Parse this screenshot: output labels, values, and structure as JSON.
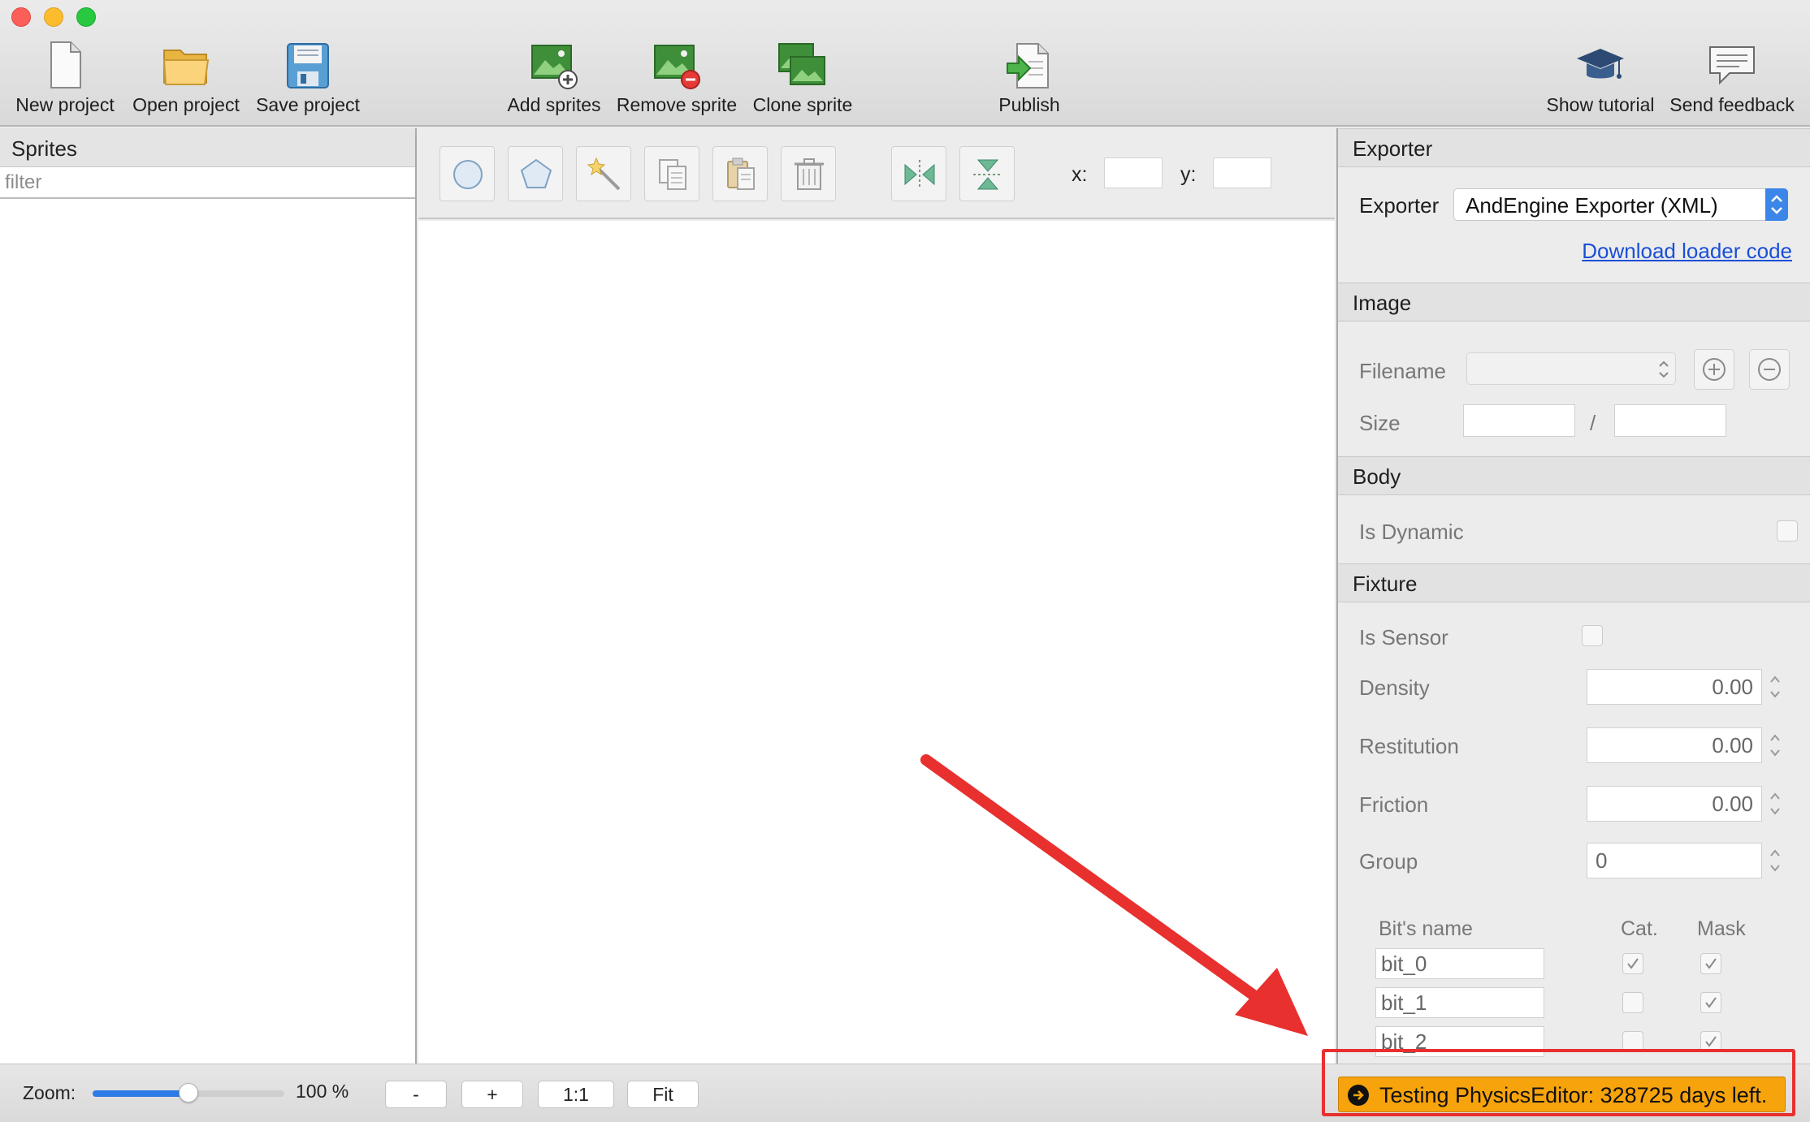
{
  "toolbar": {
    "new_project": "New project",
    "open_project": "Open project",
    "save_project": "Save project",
    "add_sprites": "Add sprites",
    "remove_sprite": "Remove sprite",
    "clone_sprite": "Clone sprite",
    "publish": "Publish",
    "show_tutorial": "Show tutorial",
    "send_feedback": "Send feedback"
  },
  "sprites": {
    "header": "Sprites",
    "filter_placeholder": "filter"
  },
  "canvas_toolbar": {
    "x_label": "x:",
    "y_label": "y:",
    "x_value": "",
    "y_value": ""
  },
  "exporter": {
    "section": "Exporter",
    "label": "Exporter",
    "value": "AndEngine Exporter (XML)",
    "download_link": "Download loader code"
  },
  "image": {
    "section": "Image",
    "filename_label": "Filename",
    "filename_value": "",
    "size_label": "Size",
    "size_separator": "/",
    "width_value": "",
    "height_value": ""
  },
  "body": {
    "section": "Body",
    "is_dynamic_label": "Is Dynamic",
    "is_dynamic": false
  },
  "fixture": {
    "section": "Fixture",
    "is_sensor_label": "Is Sensor",
    "is_sensor": false,
    "density_label": "Density",
    "density": "0.00",
    "restitution_label": "Restitution",
    "restitution": "0.00",
    "friction_label": "Friction",
    "friction": "0.00",
    "group_label": "Group",
    "group": "0",
    "bits_header": {
      "name": "Bit's name",
      "cat": "Cat.",
      "mask": "Mask"
    },
    "bits": [
      {
        "name": "bit_0",
        "cat": true,
        "mask": true
      },
      {
        "name": "bit_1",
        "cat": false,
        "mask": true
      },
      {
        "name": "bit_2",
        "cat": false,
        "mask": true
      }
    ]
  },
  "bottom": {
    "zoom_label": "Zoom:",
    "zoom_value": "100 %",
    "zoom_fraction": 0.5,
    "minus": "-",
    "plus": "+",
    "one_to_one": "1:1",
    "fit": "Fit",
    "status": "Testing PhysicsEditor: 328725 days left."
  },
  "colors": {
    "status_bg": "#f7a30c",
    "highlight": "#e8302f",
    "link": "#1a4fd6",
    "accent": "#2f7be5"
  }
}
